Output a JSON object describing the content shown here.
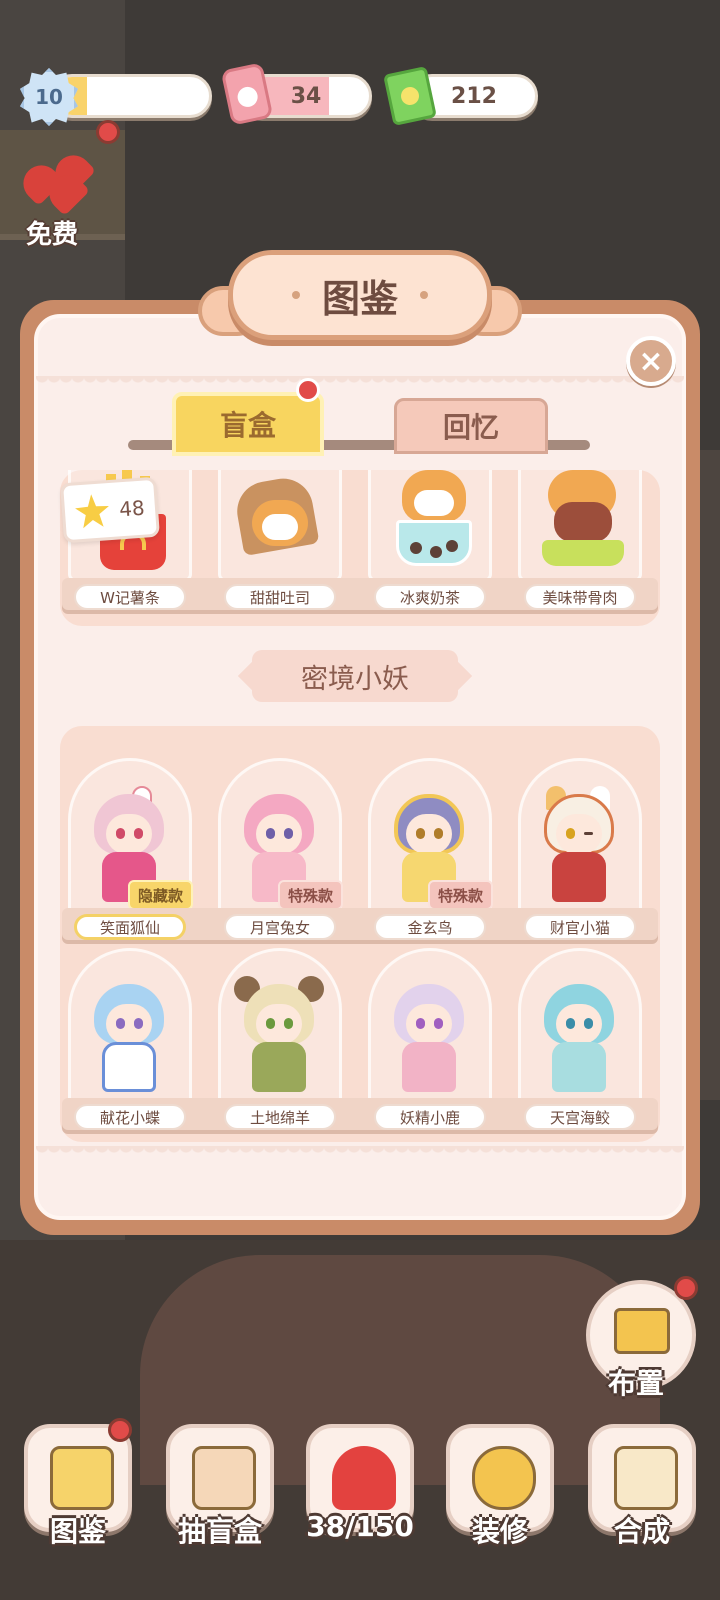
{
  "status": {
    "level": "10",
    "level_progress": 0.22,
    "energy": "34",
    "energy_progress": 0.68,
    "cash": "212"
  },
  "free_button": {
    "label": "免费"
  },
  "panel": {
    "title": "图鉴",
    "close_icon": "×",
    "tabs": [
      {
        "label": "盲盒",
        "active": true
      },
      {
        "label": "回忆",
        "active": false
      }
    ]
  },
  "food_shelf": {
    "star_count": "48",
    "items": [
      {
        "label": "W记薯条"
      },
      {
        "label": "甜甜吐司"
      },
      {
        "label": "冰爽奶茶"
      },
      {
        "label": "美味带骨肉"
      }
    ]
  },
  "section": {
    "title": "密境小妖",
    "items": [
      {
        "label": "笑面狐仙",
        "tag": "隐藏款"
      },
      {
        "label": "月宫兔女",
        "tag": "特殊款"
      },
      {
        "label": "金玄鸟",
        "tag": "特殊款"
      },
      {
        "label": "财官小猫",
        "tag": ""
      },
      {
        "label": "献花小蝶",
        "tag": ""
      },
      {
        "label": "土地绵羊",
        "tag": ""
      },
      {
        "label": "妖精小鹿",
        "tag": ""
      },
      {
        "label": "天宫海鲛",
        "tag": ""
      }
    ]
  },
  "layout_button": {
    "label": "布置"
  },
  "bottom_bar": [
    {
      "label": "图鉴"
    },
    {
      "label": "抽盲盒"
    },
    {
      "label": "38/150"
    },
    {
      "label": "装修"
    },
    {
      "label": "合成"
    }
  ]
}
